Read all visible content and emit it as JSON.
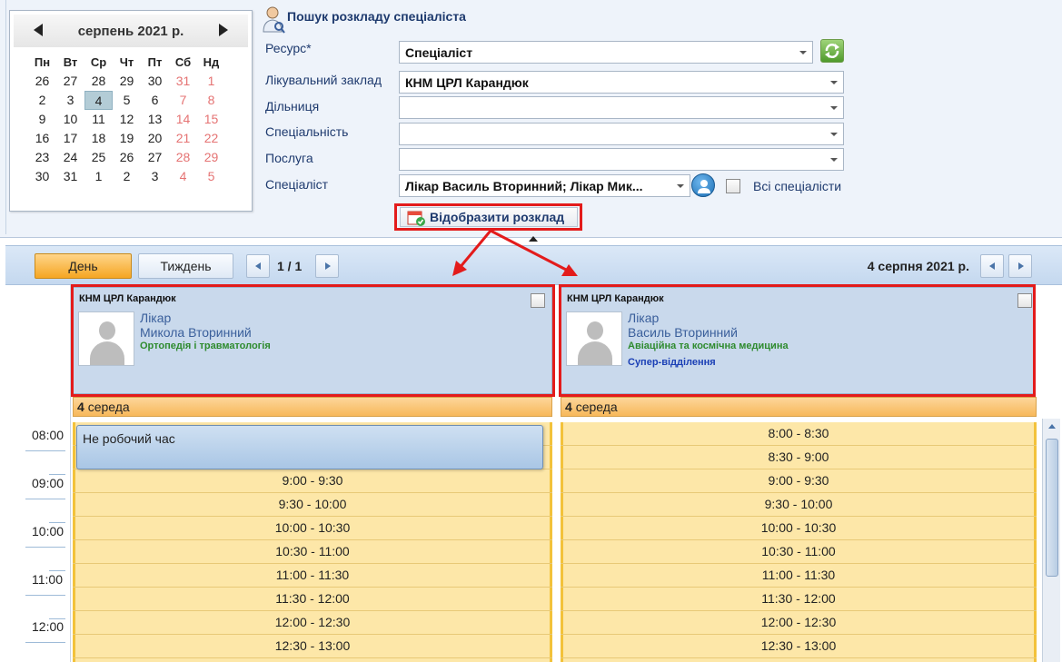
{
  "calendar": {
    "month_title": "серпень 2021 р.",
    "weekdays": [
      "Пн",
      "Вт",
      "Ср",
      "Чт",
      "Пт",
      "Сб",
      "Нд"
    ],
    "weeks": [
      [
        "26",
        "27",
        "28",
        "29",
        "30",
        "31",
        "1"
      ],
      [
        "2",
        "3",
        "4",
        "5",
        "6",
        "7",
        "8"
      ],
      [
        "9",
        "10",
        "11",
        "12",
        "13",
        "14",
        "15"
      ],
      [
        "16",
        "17",
        "18",
        "19",
        "20",
        "21",
        "22"
      ],
      [
        "23",
        "24",
        "25",
        "26",
        "27",
        "28",
        "29"
      ],
      [
        "30",
        "31",
        "1",
        "2",
        "3",
        "4",
        "5"
      ]
    ],
    "selected": "4"
  },
  "search": {
    "title": "Пошук розкладу спеціаліста",
    "resource_label": "Ресурс*",
    "resource_value": "Спеціаліст",
    "facility_label": "Лікувальний заклад",
    "facility_value": "КНМ ЦРЛ Карандюк",
    "district_label": "Дільниця",
    "district_value": "",
    "specialty_label": "Спеціальність",
    "specialty_value": "",
    "service_label": "Послуга",
    "service_value": "",
    "specialist_label": "Спеціаліст",
    "specialist_value": "Лікар Василь Вторинний; Лікар Мик...",
    "all_specialists_label": "Всі спеціалісти",
    "show_button_label": "Відобразити розклад"
  },
  "toolbar": {
    "day_label": "День",
    "week_label": "Тиждень",
    "page_indicator": "1 / 1",
    "date_label": "4 серпня 2021 р."
  },
  "time_labels": [
    "08:00",
    "09:00",
    "10:00",
    "11:00",
    "12:00"
  ],
  "columns": [
    {
      "org": "КНМ ЦРЛ Карандюк",
      "role": "Лікар",
      "name": "Микола Вторинний",
      "specialty": "Ортопедія і травматологія",
      "department": "",
      "day_num": "4",
      "day_name": "середа",
      "non_working": "Не робочий час",
      "slots": [
        "9:00 - 9:30",
        "9:30 - 10:00",
        "10:00 - 10:30",
        "10:30 - 11:00",
        "11:00 - 11:30",
        "11:30 - 12:00",
        "12:00 - 12:30",
        "12:30 - 13:00"
      ]
    },
    {
      "org": "КНМ ЦРЛ Карандюк",
      "role": "Лікар",
      "name": "Василь Вторинний",
      "specialty": "Авіаційна та космічна медицина",
      "department": "Супер-відділення",
      "day_num": "4",
      "day_name": "середа",
      "slots": [
        "8:00 - 8:30",
        "8:30 - 9:00",
        "9:00 - 9:30",
        "9:30 - 10:00",
        "10:00 - 10:30",
        "10:30 - 11:00",
        "11:00 - 11:30",
        "11:30 - 12:00",
        "12:00 - 12:30",
        "12:30 - 13:00"
      ]
    }
  ],
  "colors": {
    "highlight": "#e31b1b",
    "accent_orange": "#f5a623",
    "slot_bg": "#fde7a8",
    "header_blue": "#c9d9ec"
  }
}
